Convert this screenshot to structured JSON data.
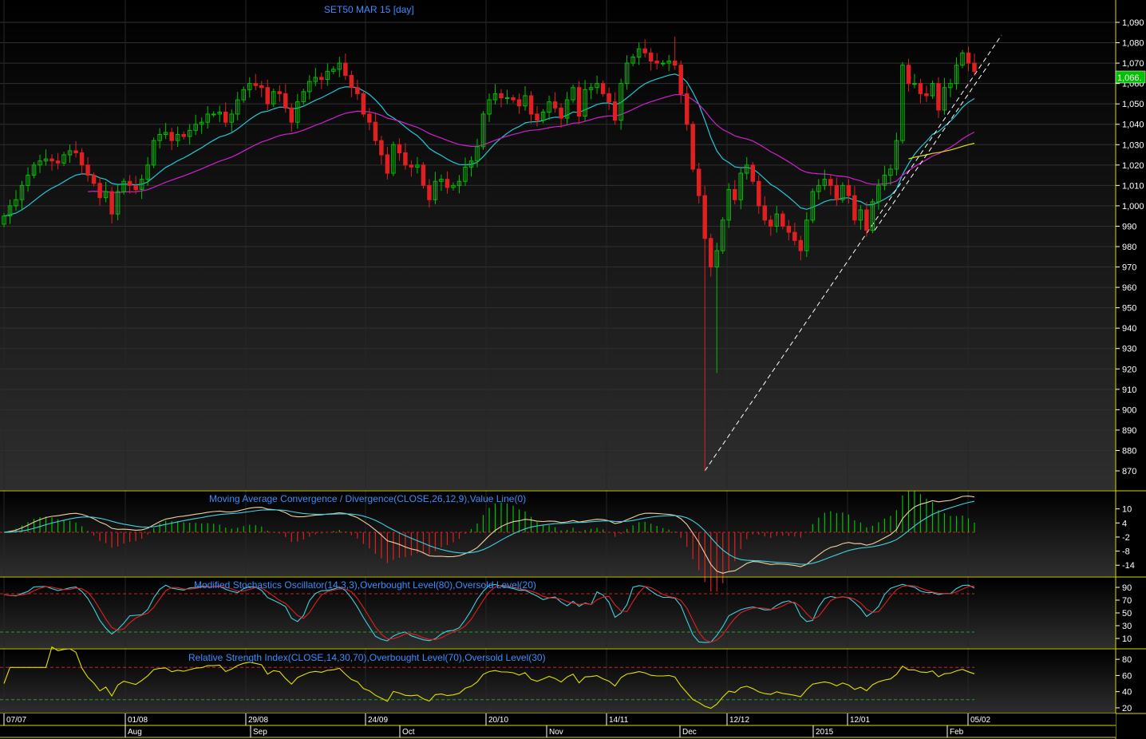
{
  "main": {
    "title": "SET50 MAR 15   [day]",
    "price_badge": "1,066.",
    "y_ticks": [
      "1,090",
      "1,080",
      "1,070",
      "1,060",
      "1,050",
      "1,040",
      "1,030",
      "1,020",
      "1,010",
      "1,000",
      "990",
      "980",
      "970",
      "960",
      "950",
      "940",
      "930",
      "920",
      "910",
      "900",
      "890",
      "880",
      "870"
    ]
  },
  "macd": {
    "title": "Moving Average Convergence / Divergence(CLOSE,26,12,9),Value Line(0)",
    "y_ticks": [
      "10",
      "4",
      "-2",
      "-8",
      "-14"
    ]
  },
  "stoch": {
    "title": "Modified Stochastics Oscillator(14,3,3),Overbought Level(80),Oversold Level(20)",
    "y_ticks": [
      "90",
      "70",
      "50",
      "30",
      "10"
    ]
  },
  "rsi": {
    "title": "Relative Strength Index(CLOSE,14,30,70),Overbought Level(70),Oversold Level(30)",
    "y_ticks": [
      "80",
      "60",
      "40",
      "20"
    ]
  },
  "x_axis": {
    "dates": [
      "07/07",
      "01/08",
      "29/08",
      "24/09",
      "20/10",
      "14/11",
      "12/12",
      "12/01",
      "05/02"
    ],
    "months": [
      "Aug",
      "Sep",
      "Oct",
      "Nov",
      "Dec",
      "2015",
      "Feb"
    ]
  },
  "chart_data": {
    "type": "candlestick",
    "title": "SET50 MAR 15   [day]",
    "price_range": [
      865,
      1093
    ],
    "colors": {
      "up": "#00c000",
      "down": "#e02020",
      "ma_short": "#20c8d8",
      "ma_long": "#d020d0",
      "ma_yellow": "#e0e000",
      "trendline": "#ffffff"
    },
    "closes": [
      995,
      1000,
      1003,
      1010,
      1015,
      1020,
      1022,
      1023,
      1022,
      1021,
      1025,
      1027,
      1026,
      1020,
      1015,
      1011,
      1004,
      1007,
      996,
      1007,
      1012,
      1010,
      1008,
      1013,
      1020,
      1032,
      1035,
      1036,
      1032,
      1035,
      1034,
      1037,
      1040,
      1041,
      1045,
      1045,
      1046,
      1041,
      1045,
      1052,
      1057,
      1060,
      1059,
      1058,
      1050,
      1056,
      1055,
      1048,
      1041,
      1051,
      1056,
      1061,
      1063,
      1062,
      1066,
      1067,
      1070,
      1064,
      1058,
      1055,
      1045,
      1041,
      1032,
      1025,
      1016,
      1030,
      1026,
      1020,
      1019,
      1020,
      1010,
      1003,
      1012,
      1013,
      1009,
      1010,
      1012,
      1019,
      1022,
      1029,
      1045,
      1052,
      1055,
      1053,
      1053,
      1052,
      1049,
      1054,
      1045,
      1042,
      1046,
      1051,
      1048,
      1043,
      1052,
      1058,
      1044,
      1057,
      1058,
      1060,
      1055,
      1051,
      1042,
      1060,
      1070,
      1073,
      1077,
      1075,
      1071,
      1070,
      1070,
      1071,
      1069,
      1055,
      1040,
      1018,
      1005,
      984,
      970,
      978,
      993,
      1008,
      1003,
      1016,
      1020,
      1012,
      1000,
      993,
      990,
      996,
      990,
      987,
      983,
      978,
      993,
      1007,
      1010,
      1013,
      1010,
      1003,
      1010,
      1005,
      993,
      998,
      988,
      1002,
      1010,
      1015,
      1018,
      1032,
      1069,
      1060,
      1060,
      1055,
      1054,
      1060,
      1047,
      1058,
      1060,
      1069,
      1075,
      1070,
      1066
    ],
    "macd_range": [
      -18,
      16
    ],
    "stoch_range": [
      0,
      100
    ],
    "stoch_levels": [
      80,
      20
    ],
    "rsi_range": [
      15,
      90
    ],
    "rsi_levels": [
      70,
      30
    ],
    "macd_ticks": [
      10,
      4,
      -2,
      -8,
      -14
    ],
    "stoch_ticks": [
      90,
      70,
      50,
      30,
      10
    ],
    "rsi_ticks": [
      80,
      60,
      40,
      20
    ]
  }
}
